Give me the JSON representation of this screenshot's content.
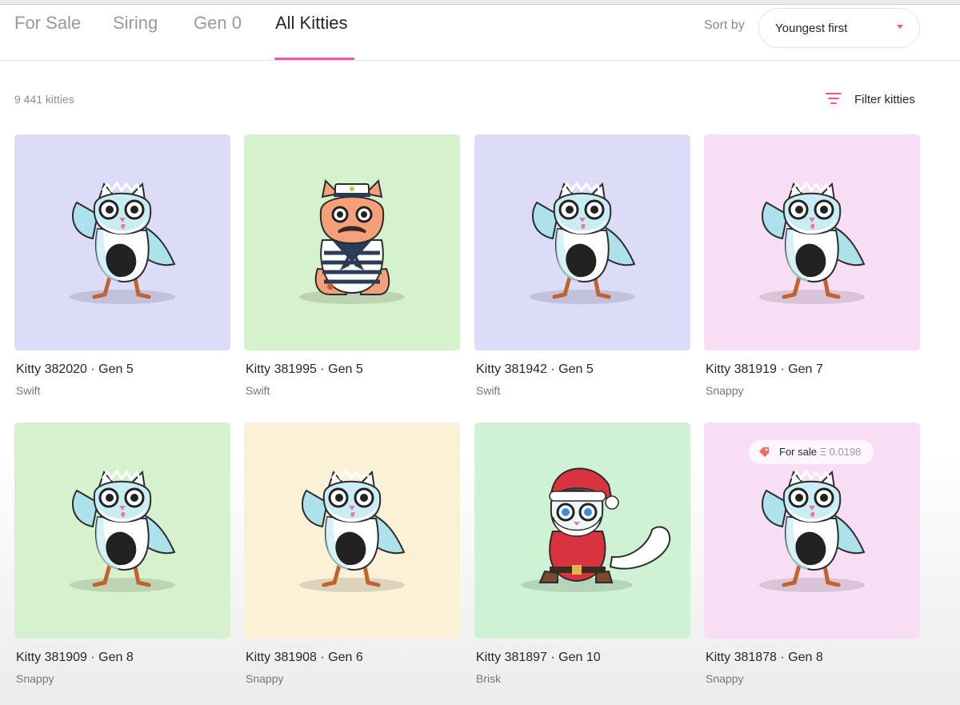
{
  "tabs": [
    {
      "label": "For Sale"
    },
    {
      "label": "Siring"
    },
    {
      "label": "Gen 0"
    },
    {
      "label": "All Kitties"
    }
  ],
  "sort": {
    "label": "Sort by",
    "value": "Youngest first"
  },
  "count_text": "9 441 kitties",
  "filter_label": "Filter kitties",
  "colors": {
    "accent": "#ef52a7"
  },
  "kitties": [
    {
      "name": "Kitty 382020 · Gen 5",
      "speed": "Swift",
      "bg": "#dcdcf9",
      "art": "bird-cat"
    },
    {
      "name": "Kitty 381995 · Gen 5",
      "speed": "Swift",
      "bg": "#d6f2cc",
      "art": "sailor-cat"
    },
    {
      "name": "Kitty 381942 · Gen 5",
      "speed": "Swift",
      "bg": "#dcdcf9",
      "art": "bird-cat"
    },
    {
      "name": "Kitty 381919 · Gen 7",
      "speed": "Snappy",
      "bg": "#f8def5",
      "art": "bird-cat"
    },
    {
      "name": "Kitty 381909 · Gen 8",
      "speed": "Snappy",
      "bg": "#d6f2cc",
      "art": "bird-cat"
    },
    {
      "name": "Kitty 381908 · Gen 6",
      "speed": "Snappy",
      "bg": "#fbf1d6",
      "art": "bird-cat"
    },
    {
      "name": "Kitty 381897 · Gen 10",
      "speed": "Brisk",
      "bg": "#cff2d4",
      "art": "santa-cat"
    },
    {
      "name": "Kitty 381878 · Gen 8",
      "speed": "Snappy",
      "bg": "#f8def5",
      "art": "bird-cat",
      "sale": {
        "label": "For sale",
        "price": "Ξ 0.0198"
      }
    }
  ]
}
